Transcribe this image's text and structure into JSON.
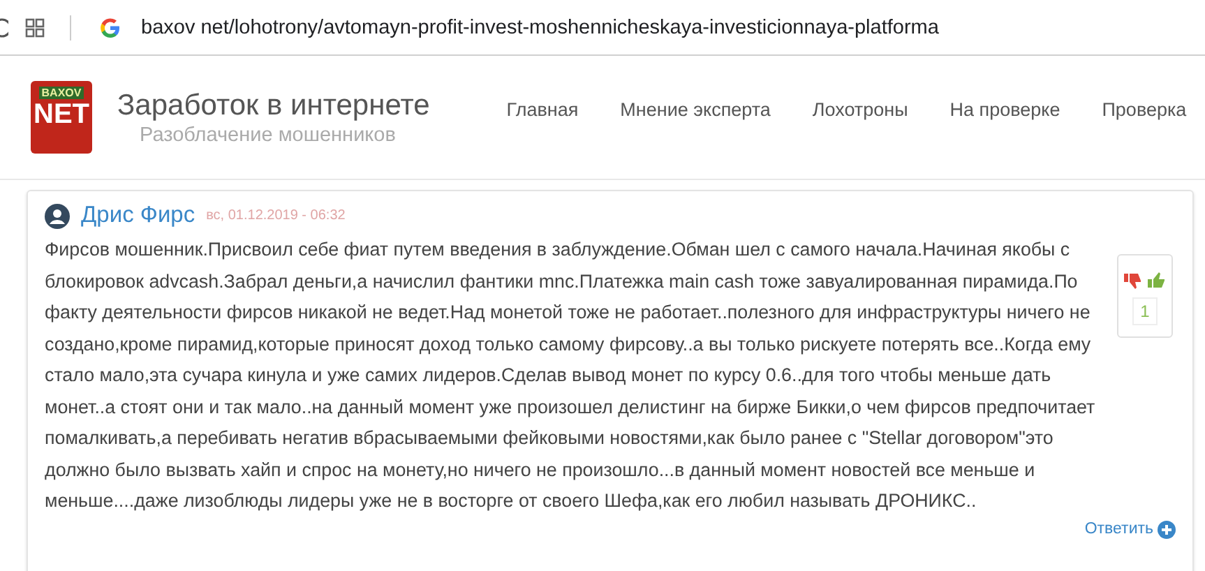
{
  "browser": {
    "url": "baxov net/lohotrony/avtomayn-profit-invest-moshennicheskaya-investicionnaya-platforma"
  },
  "site": {
    "logo": {
      "top": "BAXOV",
      "main": "NET"
    },
    "title": "Заработок в интернете",
    "subtitle": "Разоблачение мошенников"
  },
  "nav": [
    {
      "label": "Главная"
    },
    {
      "label": "Мнение эксперта"
    },
    {
      "label": "Лохотроны"
    },
    {
      "label": "На проверке"
    },
    {
      "label": "Проверка"
    }
  ],
  "comment": {
    "author": "Дрис Фирс",
    "date": "вс, 01.12.2019 - 06:32",
    "text": "Фирсов мошенник.Присвоил себе фиат путем введения в заблуждение.Обман шел с самого начала.Начиная якобы с блокировок advcash.Забрал деньги,а начислил фантики mnc.Платежка main cash тоже завуалированная пирамида.По факту деятельности фирсов никакой не ведет.Над монетой тоже не работает..полезного для инфраструктуры ничего не создано,кроме пирамид,которые приносят доход только самому фирсову..а вы только рискуете потерять все..Когда ему стало мало,эта сучара кинула и уже самих лидеров.Сделав вывод монет по курсу 0.6..для того чтобы меньше дать монет..а стоят они и так мало..на данный момент уже произошел делистинг на бирже Бикки,о чем фирсов предпочитает помалкивать,а перебивать негатив вбрасываемыми фейковыми новостями,как было ранее с \"Stellar договором\"это должно было вызвать хайп и спрос на монету,но ничего не произошло...в данный момент новостей все меньше и меньше....даже лизоблюды лидеры уже не в восторге от своего Шефа,как его любил называть ДРОНИКС..",
    "votes": "1",
    "reply": "Ответить"
  }
}
